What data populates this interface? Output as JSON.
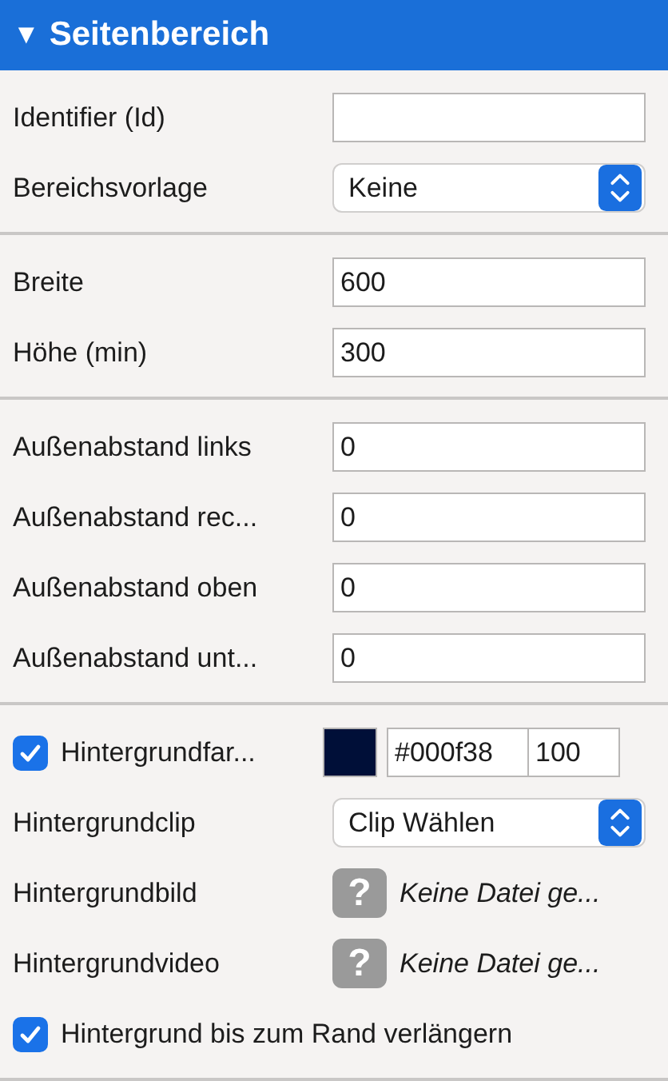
{
  "panel": {
    "title": "Seitenbereich",
    "toggle": "▼",
    "expanded": true
  },
  "sections": [
    {
      "rows": [
        {
          "kind": "text",
          "label": "Identifier (Id)",
          "value": ""
        },
        {
          "kind": "select",
          "label": "Bereichsvorlage",
          "value": "Keine"
        }
      ]
    },
    {
      "rows": [
        {
          "kind": "text",
          "label": "Breite",
          "value": "600"
        },
        {
          "kind": "text",
          "label": "Höhe (min)",
          "value": "300"
        }
      ]
    },
    {
      "rows": [
        {
          "kind": "text",
          "label": "Außenabstand links",
          "value": "0"
        },
        {
          "kind": "text",
          "label": "Außenabstand rec...",
          "value": "0"
        },
        {
          "kind": "text",
          "label": "Außenabstand oben",
          "value": "0"
        },
        {
          "kind": "text",
          "label": "Außenabstand unt...",
          "value": "0"
        }
      ]
    },
    {
      "rows": [
        {
          "kind": "color",
          "label": "Hintergrundfar...",
          "checked": true,
          "value": "#000f38",
          "opacity": "100"
        },
        {
          "kind": "select",
          "label": "Hintergrundclip",
          "value": "Clip Wählen"
        },
        {
          "kind": "file",
          "label": "Hintergrundbild",
          "icon": "?",
          "value": "Keine Datei ge..."
        },
        {
          "kind": "file",
          "label": "Hintergrundvideo",
          "icon": "?",
          "value": "Keine Datei ge..."
        },
        {
          "kind": "checkbox",
          "label": "Hintergrund bis zum Rand verlängern",
          "checked": true
        }
      ]
    }
  ]
}
